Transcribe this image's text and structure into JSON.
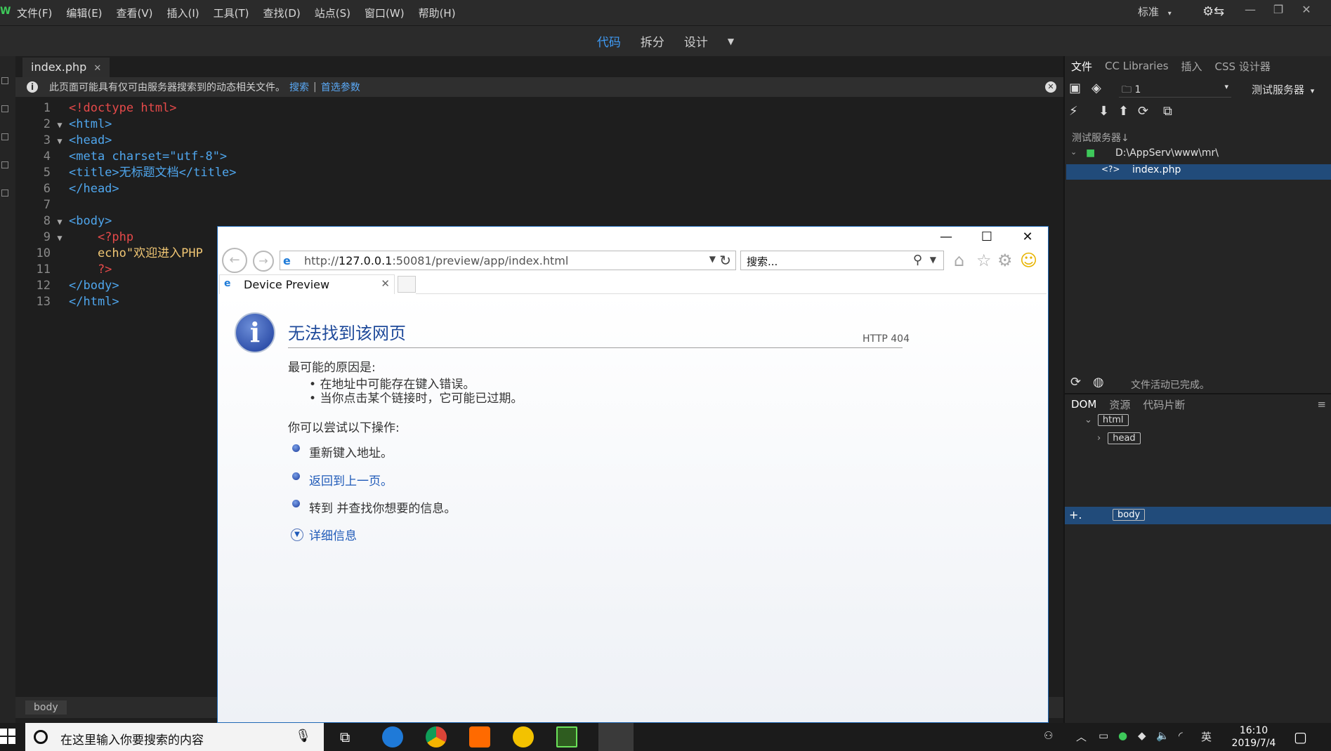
{
  "menubar": {
    "logo": "W",
    "items": [
      "文件(F)",
      "编辑(E)",
      "查看(V)",
      "插入(I)",
      "工具(T)",
      "查找(D)",
      "站点(S)",
      "窗口(W)",
      "帮助(H)"
    ],
    "layout": "标准"
  },
  "viewbar": {
    "code": "代码",
    "split": "拆分",
    "design": "设计"
  },
  "document": {
    "tab": "index.php",
    "info_message": "此页面可能具有仅可由服务器搜索到的动态相关文件。",
    "search_link": "搜索",
    "separator": "|",
    "prefs_link": "首选参数"
  },
  "code_lines": [
    {
      "n": "1",
      "fold": "",
      "text": "<!doctype html>"
    },
    {
      "n": "2",
      "fold": "▼",
      "text": "<html>"
    },
    {
      "n": "3",
      "fold": "▼",
      "text": "<head>"
    },
    {
      "n": "4",
      "fold": "",
      "text": "<meta charset=\"utf-8\">"
    },
    {
      "n": "5",
      "fold": "",
      "text": "<title>无标题文档</title>"
    },
    {
      "n": "6",
      "fold": "",
      "text": "</head>"
    },
    {
      "n": "7",
      "fold": "",
      "text": ""
    },
    {
      "n": "8",
      "fold": "▼",
      "text": "<body>"
    },
    {
      "n": "9",
      "fold": "▼",
      "text": "    <?php"
    },
    {
      "n": "10",
      "fold": "",
      "text": "    echo\"欢迎进入PHP"
    },
    {
      "n": "11",
      "fold": "",
      "text": "    ?>"
    },
    {
      "n": "12",
      "fold": "",
      "text": "</body>"
    },
    {
      "n": "13",
      "fold": "",
      "text": "</html>"
    }
  ],
  "statusbar": {
    "tag": "body"
  },
  "files_panel": {
    "tabs": [
      "文件",
      "CC Libraries",
      "插入",
      "CSS 设计器"
    ],
    "folder": "1",
    "server": "测试服务器",
    "server_label": "测试服务器",
    "root_path": "D:\\AppServ\\www\\mr\\",
    "file_icon": "<?>",
    "file_name": "index.php",
    "status": "文件活动已完成。"
  },
  "dom_panel": {
    "tabs": [
      "DOM",
      "资源",
      "代码片断"
    ],
    "nodes": [
      "html",
      "head",
      "body"
    ]
  },
  "taskbar": {
    "search_placeholder": "在这里输入你要搜索的内容",
    "ime": "英",
    "time": "16:10",
    "date": "2019/7/4"
  },
  "browser": {
    "url_prefix": "http://",
    "url_host": "127.0.0.1",
    "url_rest": ":50081/preview/app/index.html",
    "search_placeholder": "搜索...",
    "tab_label": "Device Preview",
    "error_title": "无法找到该网页",
    "http_code": "HTTP 404",
    "cause_label": "最可能的原因是:",
    "causes": [
      "在地址中可能存在键入错误。",
      "当你点击某个链接时，它可能已过期。"
    ],
    "try_label": "你可以尝试以下操作:",
    "actions": [
      "重新键入地址。",
      "返回到上一页。",
      "转到  并查找你想要的信息。"
    ],
    "details": "详细信息"
  },
  "colors": {
    "accent": "#3f9bf5",
    "selection": "#214b7a",
    "link": "#1f5ab8"
  }
}
